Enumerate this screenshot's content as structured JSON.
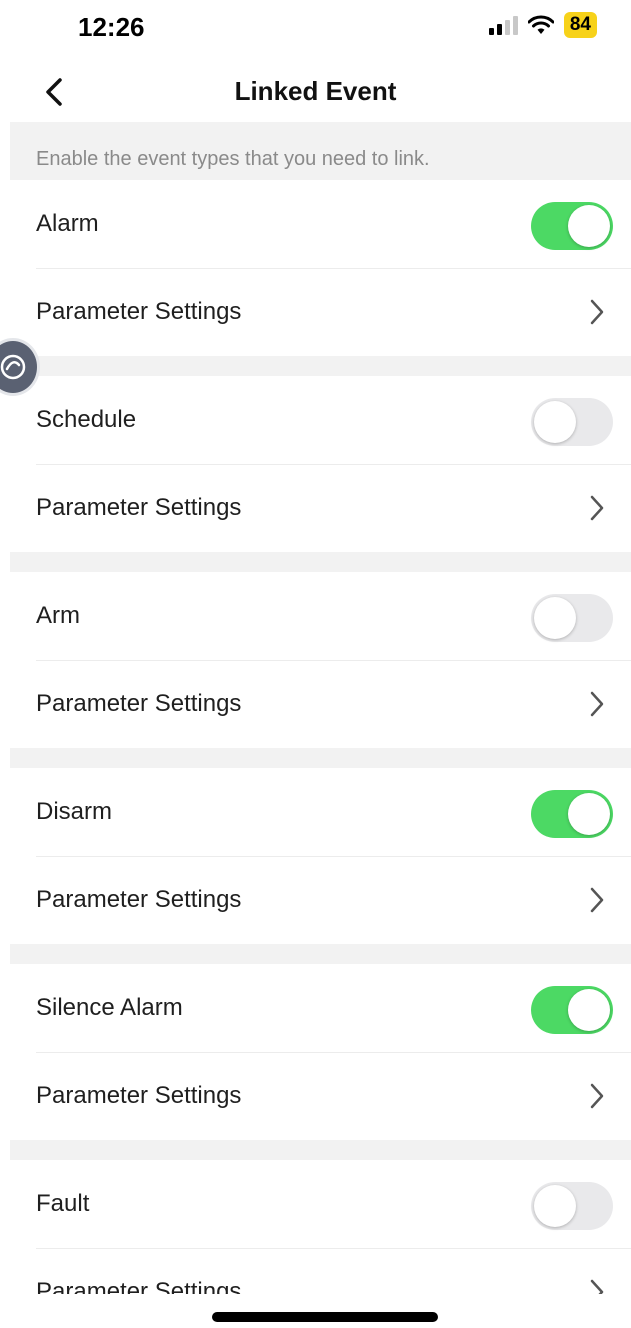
{
  "status_bar": {
    "time": "12:26",
    "battery": "84"
  },
  "nav": {
    "title": "Linked Event"
  },
  "hint": "Enable the event types that you need to link.",
  "events": [
    {
      "label": "Alarm",
      "enabled": true,
      "settings_label": "Parameter Settings"
    },
    {
      "label": "Schedule",
      "enabled": false,
      "settings_label": "Parameter Settings"
    },
    {
      "label": "Arm",
      "enabled": false,
      "settings_label": "Parameter Settings"
    },
    {
      "label": "Disarm",
      "enabled": true,
      "settings_label": "Parameter Settings"
    },
    {
      "label": "Silence Alarm",
      "enabled": true,
      "settings_label": "Parameter Settings"
    },
    {
      "label": "Fault",
      "enabled": false,
      "settings_label": "Parameter Settings"
    }
  ],
  "icons": {
    "back": "chevron-left-icon",
    "row_arrow": "chevron-right-icon",
    "assistive": "assistive-touch-icon",
    "signal": "cellular-signal-icon",
    "wifi": "wifi-icon",
    "battery": "battery-icon"
  },
  "colors": {
    "toggle_on": "#4cd964",
    "toggle_off": "#e9e9eb",
    "battery": "#f7d21a"
  }
}
